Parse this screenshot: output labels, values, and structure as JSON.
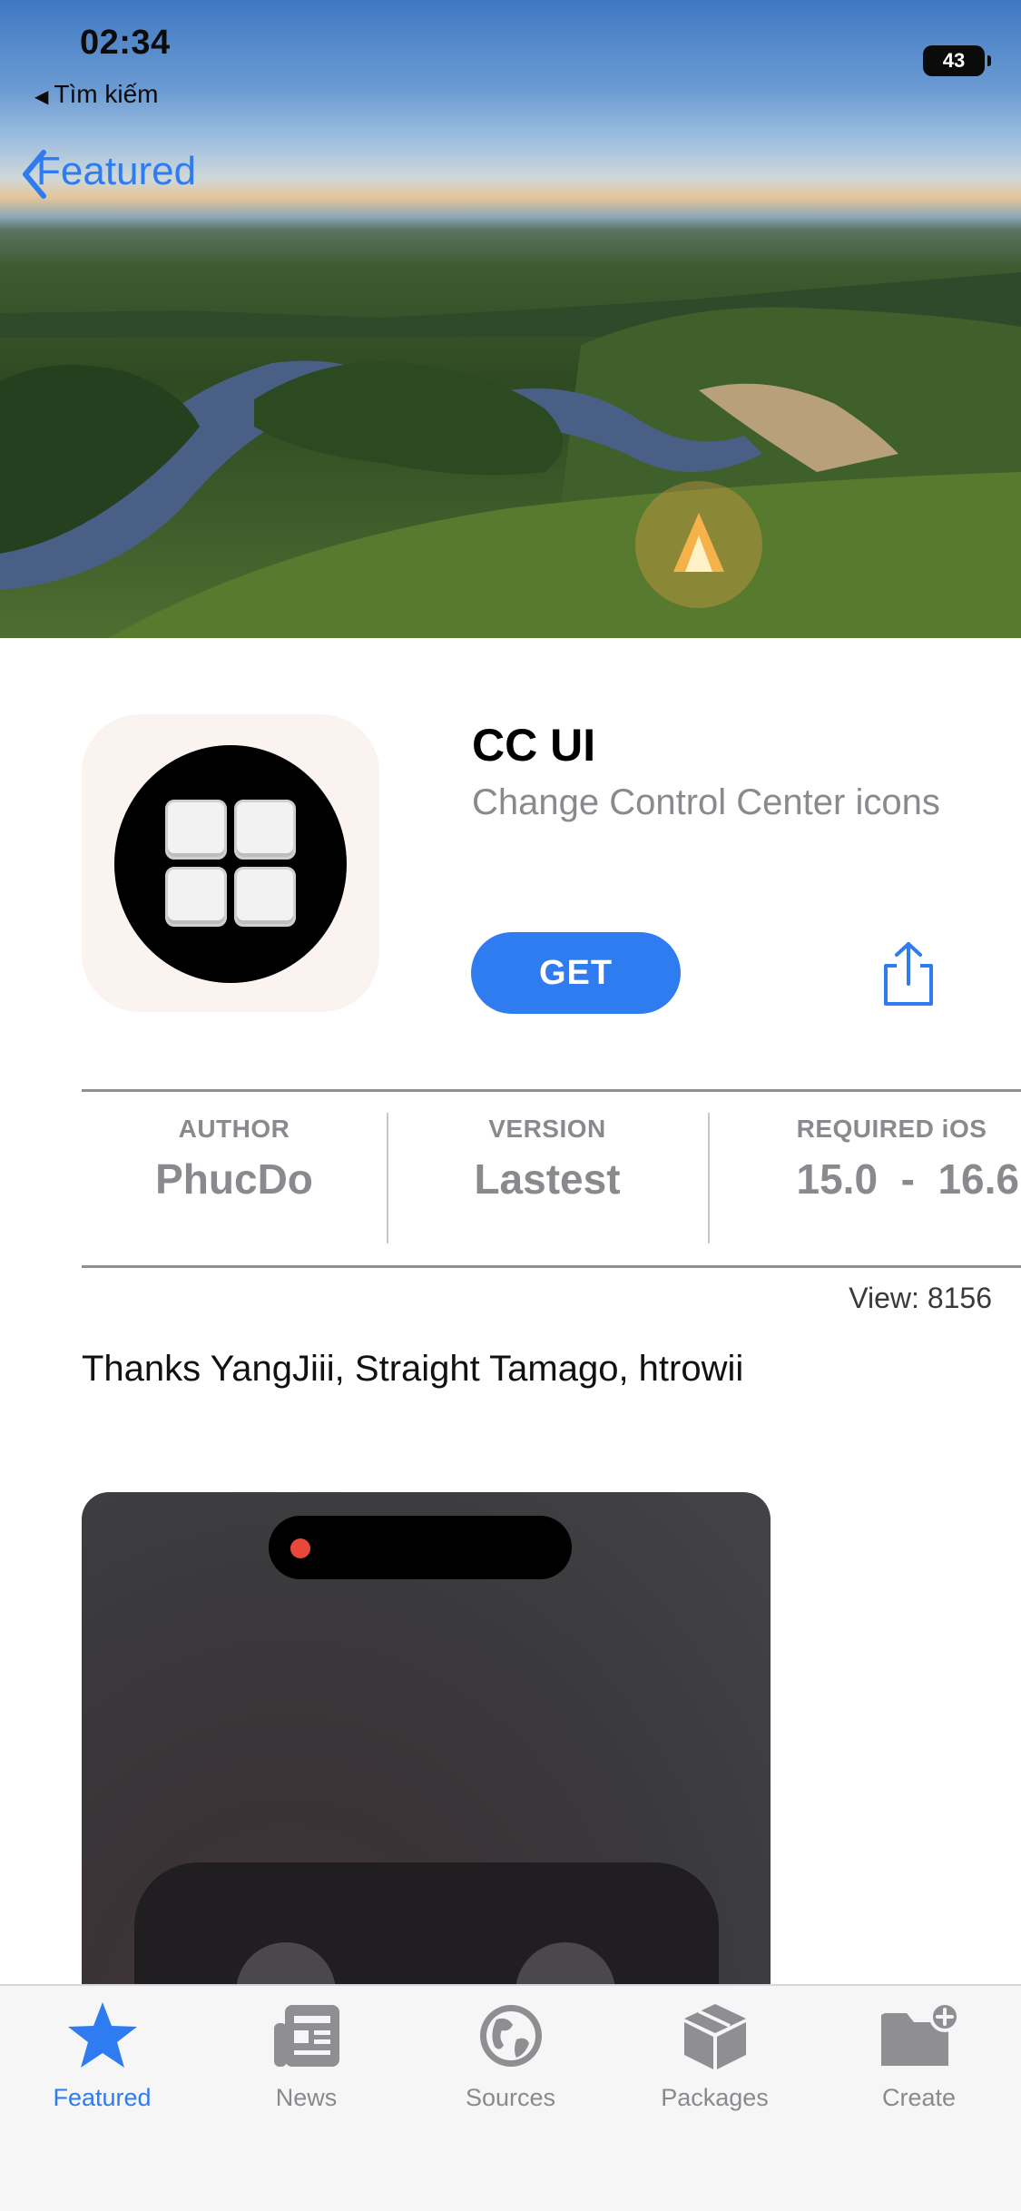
{
  "status_bar": {
    "time": "02:34",
    "back_label": "Tìm kiếm",
    "battery": "43"
  },
  "nav": {
    "back_label": "Featured"
  },
  "app": {
    "name": "CC UI",
    "subtitle": "Change Control Center icons",
    "get_label": "GET"
  },
  "info": {
    "author_label": "AUTHOR",
    "author_value": "PhucDo",
    "version_label": "VERSION",
    "version_value": "Lastest",
    "ios_label": "REQUIRED iOS",
    "ios_value": "15.0  -  16.6"
  },
  "views": "View: 8156",
  "credits": "Thanks YangJiii, Straight Tamago, htrowii",
  "tabs": [
    {
      "label": "Featured",
      "icon": "star-icon",
      "active": true
    },
    {
      "label": "News",
      "icon": "newspaper-icon",
      "active": false
    },
    {
      "label": "Sources",
      "icon": "globe-icon",
      "active": false
    },
    {
      "label": "Packages",
      "icon": "package-box-icon",
      "active": false
    },
    {
      "label": "Create",
      "icon": "folder-plus-icon",
      "active": false
    }
  ],
  "colors": {
    "accent": "#2f7bf0",
    "muted_text": "#8a8a8e",
    "tab_bar": "#f6f6f7"
  }
}
